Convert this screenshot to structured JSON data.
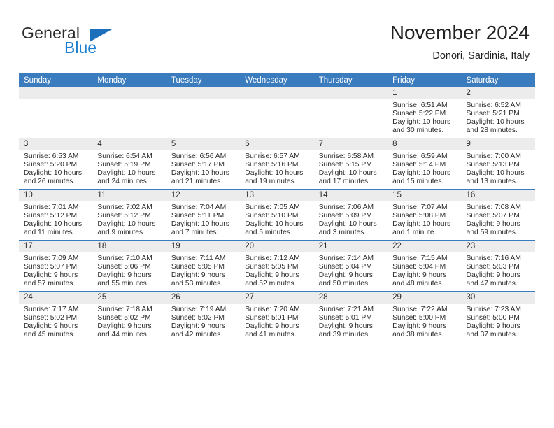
{
  "brand": {
    "name_part1": "General",
    "name_part2": "Blue",
    "triangle_color": "#1c6fba",
    "blue_color": "#1c7fd0"
  },
  "header": {
    "title": "November 2024",
    "subtitle": "Donori, Sardinia, Italy"
  },
  "theme": {
    "header_blue": "#3a7cbe",
    "daynum_band": "#ececec",
    "text": "#2b2b2b"
  },
  "calendar": {
    "weekday_headers": [
      "Sunday",
      "Monday",
      "Tuesday",
      "Wednesday",
      "Thursday",
      "Friday",
      "Saturday"
    ],
    "labels": {
      "sunrise": "Sunrise:",
      "sunset": "Sunset:",
      "daylight": "Daylight:"
    },
    "weeks": [
      [
        {
          "day": "",
          "sunrise": "",
          "sunset": "",
          "daylight": ""
        },
        {
          "day": "",
          "sunrise": "",
          "sunset": "",
          "daylight": ""
        },
        {
          "day": "",
          "sunrise": "",
          "sunset": "",
          "daylight": ""
        },
        {
          "day": "",
          "sunrise": "",
          "sunset": "",
          "daylight": ""
        },
        {
          "day": "",
          "sunrise": "",
          "sunset": "",
          "daylight": ""
        },
        {
          "day": "1",
          "sunrise": "Sunrise: 6:51 AM",
          "sunset": "Sunset: 5:22 PM",
          "daylight": "Daylight: 10 hours and 30 minutes."
        },
        {
          "day": "2",
          "sunrise": "Sunrise: 6:52 AM",
          "sunset": "Sunset: 5:21 PM",
          "daylight": "Daylight: 10 hours and 28 minutes."
        }
      ],
      [
        {
          "day": "3",
          "sunrise": "Sunrise: 6:53 AM",
          "sunset": "Sunset: 5:20 PM",
          "daylight": "Daylight: 10 hours and 26 minutes."
        },
        {
          "day": "4",
          "sunrise": "Sunrise: 6:54 AM",
          "sunset": "Sunset: 5:19 PM",
          "daylight": "Daylight: 10 hours and 24 minutes."
        },
        {
          "day": "5",
          "sunrise": "Sunrise: 6:56 AM",
          "sunset": "Sunset: 5:17 PM",
          "daylight": "Daylight: 10 hours and 21 minutes."
        },
        {
          "day": "6",
          "sunrise": "Sunrise: 6:57 AM",
          "sunset": "Sunset: 5:16 PM",
          "daylight": "Daylight: 10 hours and 19 minutes."
        },
        {
          "day": "7",
          "sunrise": "Sunrise: 6:58 AM",
          "sunset": "Sunset: 5:15 PM",
          "daylight": "Daylight: 10 hours and 17 minutes."
        },
        {
          "day": "8",
          "sunrise": "Sunrise: 6:59 AM",
          "sunset": "Sunset: 5:14 PM",
          "daylight": "Daylight: 10 hours and 15 minutes."
        },
        {
          "day": "9",
          "sunrise": "Sunrise: 7:00 AM",
          "sunset": "Sunset: 5:13 PM",
          "daylight": "Daylight: 10 hours and 13 minutes."
        }
      ],
      [
        {
          "day": "10",
          "sunrise": "Sunrise: 7:01 AM",
          "sunset": "Sunset: 5:12 PM",
          "daylight": "Daylight: 10 hours and 11 minutes."
        },
        {
          "day": "11",
          "sunrise": "Sunrise: 7:02 AM",
          "sunset": "Sunset: 5:12 PM",
          "daylight": "Daylight: 10 hours and 9 minutes."
        },
        {
          "day": "12",
          "sunrise": "Sunrise: 7:04 AM",
          "sunset": "Sunset: 5:11 PM",
          "daylight": "Daylight: 10 hours and 7 minutes."
        },
        {
          "day": "13",
          "sunrise": "Sunrise: 7:05 AM",
          "sunset": "Sunset: 5:10 PM",
          "daylight": "Daylight: 10 hours and 5 minutes."
        },
        {
          "day": "14",
          "sunrise": "Sunrise: 7:06 AM",
          "sunset": "Sunset: 5:09 PM",
          "daylight": "Daylight: 10 hours and 3 minutes."
        },
        {
          "day": "15",
          "sunrise": "Sunrise: 7:07 AM",
          "sunset": "Sunset: 5:08 PM",
          "daylight": "Daylight: 10 hours and 1 minute."
        },
        {
          "day": "16",
          "sunrise": "Sunrise: 7:08 AM",
          "sunset": "Sunset: 5:07 PM",
          "daylight": "Daylight: 9 hours and 59 minutes."
        }
      ],
      [
        {
          "day": "17",
          "sunrise": "Sunrise: 7:09 AM",
          "sunset": "Sunset: 5:07 PM",
          "daylight": "Daylight: 9 hours and 57 minutes."
        },
        {
          "day": "18",
          "sunrise": "Sunrise: 7:10 AM",
          "sunset": "Sunset: 5:06 PM",
          "daylight": "Daylight: 9 hours and 55 minutes."
        },
        {
          "day": "19",
          "sunrise": "Sunrise: 7:11 AM",
          "sunset": "Sunset: 5:05 PM",
          "daylight": "Daylight: 9 hours and 53 minutes."
        },
        {
          "day": "20",
          "sunrise": "Sunrise: 7:12 AM",
          "sunset": "Sunset: 5:05 PM",
          "daylight": "Daylight: 9 hours and 52 minutes."
        },
        {
          "day": "21",
          "sunrise": "Sunrise: 7:14 AM",
          "sunset": "Sunset: 5:04 PM",
          "daylight": "Daylight: 9 hours and 50 minutes."
        },
        {
          "day": "22",
          "sunrise": "Sunrise: 7:15 AM",
          "sunset": "Sunset: 5:04 PM",
          "daylight": "Daylight: 9 hours and 48 minutes."
        },
        {
          "day": "23",
          "sunrise": "Sunrise: 7:16 AM",
          "sunset": "Sunset: 5:03 PM",
          "daylight": "Daylight: 9 hours and 47 minutes."
        }
      ],
      [
        {
          "day": "24",
          "sunrise": "Sunrise: 7:17 AM",
          "sunset": "Sunset: 5:02 PM",
          "daylight": "Daylight: 9 hours and 45 minutes."
        },
        {
          "day": "25",
          "sunrise": "Sunrise: 7:18 AM",
          "sunset": "Sunset: 5:02 PM",
          "daylight": "Daylight: 9 hours and 44 minutes."
        },
        {
          "day": "26",
          "sunrise": "Sunrise: 7:19 AM",
          "sunset": "Sunset: 5:02 PM",
          "daylight": "Daylight: 9 hours and 42 minutes."
        },
        {
          "day": "27",
          "sunrise": "Sunrise: 7:20 AM",
          "sunset": "Sunset: 5:01 PM",
          "daylight": "Daylight: 9 hours and 41 minutes."
        },
        {
          "day": "28",
          "sunrise": "Sunrise: 7:21 AM",
          "sunset": "Sunset: 5:01 PM",
          "daylight": "Daylight: 9 hours and 39 minutes."
        },
        {
          "day": "29",
          "sunrise": "Sunrise: 7:22 AM",
          "sunset": "Sunset: 5:00 PM",
          "daylight": "Daylight: 9 hours and 38 minutes."
        },
        {
          "day": "30",
          "sunrise": "Sunrise: 7:23 AM",
          "sunset": "Sunset: 5:00 PM",
          "daylight": "Daylight: 9 hours and 37 minutes."
        }
      ]
    ]
  }
}
